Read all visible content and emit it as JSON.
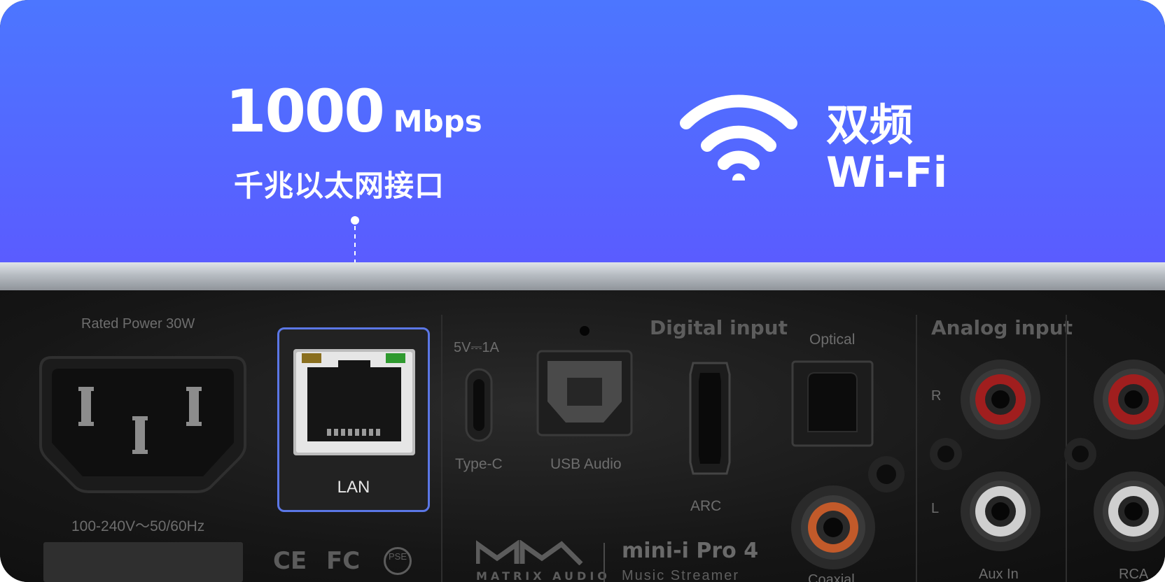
{
  "banner": {
    "speed_value": "1000",
    "speed_unit": "Mbps",
    "lan_caption": "千兆以太网接口",
    "wifi_line1": "双频",
    "wifi_line2": "Wi-Fi",
    "background_top": "#4c76ff",
    "background_bottom": "#5a5cff"
  },
  "device": {
    "rated_power": "Rated Power 30W",
    "voltage": "100-240V～50/60Hz",
    "lan_label": "LAN",
    "usbc_rating": "5V⎓1A",
    "usbc_label": "Type-C",
    "usb_audio_label": "USB Audio",
    "digital_input_heading": "Digital input",
    "optical_label": "Optical",
    "arc_label": "ARC",
    "coaxial_label": "Coaxial",
    "analog_input_heading": "Analog input",
    "channel_r": "R",
    "channel_l": "L",
    "aux_in_label": "Aux In",
    "rca_label": "RCA",
    "brand_name": "MATRIX AUDIO",
    "model_name": "mini-i Pro 4",
    "model_subtitle": "Music Streamer",
    "cert_ce": "CE",
    "cert_fc": "FC",
    "cert_pse": "PSE",
    "highlight_color": "#5b77e6",
    "rca_red": "#a01e1e",
    "rca_white": "#cfcfcf",
    "coax_orange": "#c25a2a"
  }
}
